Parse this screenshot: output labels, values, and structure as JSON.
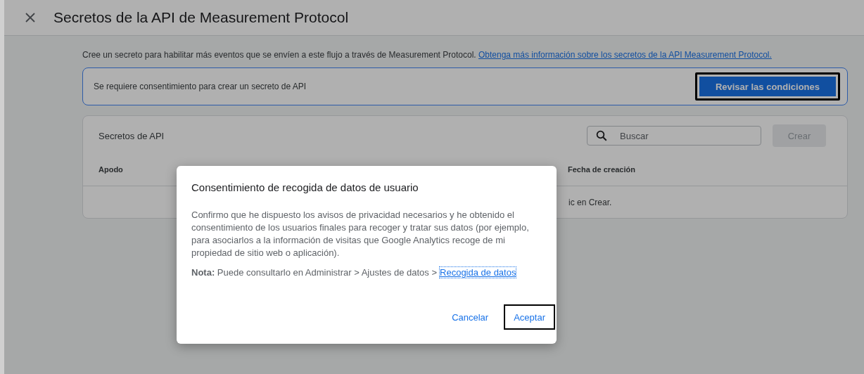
{
  "header": {
    "title": "Secretos de la API de Measurement Protocol"
  },
  "intro": {
    "text": "Cree un secreto para habilitar más eventos que se envíen a este flujo a través de Measurement Protocol.",
    "link": "Obtenga más información sobre los secretos de la API Measurement Protocol."
  },
  "consent_banner": {
    "text": "Se requiere consentimiento para crear un secreto de API",
    "button": "Revisar las condiciones",
    "highlighted": true
  },
  "secrets_card": {
    "title": "Secretos de API",
    "search": {
      "placeholder": "Buscar"
    },
    "create_button": {
      "label": "Crear",
      "disabled": true
    },
    "columns": [
      {
        "label": "Apodo"
      },
      {
        "label": "Fecha de creación"
      }
    ],
    "empty_text": "ic en Crear."
  },
  "dialog": {
    "title": "Consentimiento de recogida de datos de usuario",
    "body": "Confirmo que he dispuesto los avisos de privacidad necesarios y he obtenido el consentimiento de los usuarios finales para recoger y tratar sus datos (por ejemplo, para asociarlos a la información de visitas que Google Analytics recoge de mi propiedad de sitio web o aplicación).",
    "note": "**Nota:** Puede consultarlo en Administrar > Ajustes de datos >",
    "note_link": "Recogida de datos",
    "buttons": [
      {
        "label": "Cancelar",
        "highlighted": false
      },
      {
        "label": "Aceptar",
        "highlighted": true
      }
    ]
  }
}
